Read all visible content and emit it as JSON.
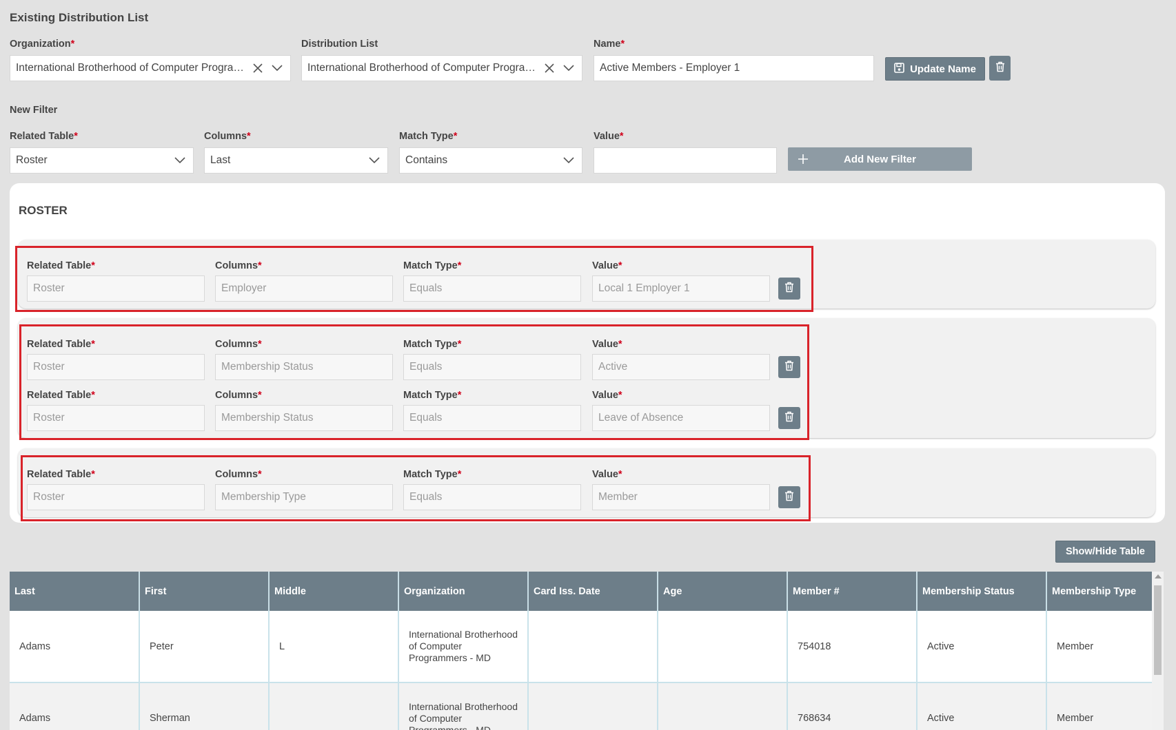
{
  "header": {
    "title": "Existing Distribution List"
  },
  "existing": {
    "organization": {
      "label": "Organization",
      "value": "International Brotherhood of Computer Programmers - MD"
    },
    "distribution_list": {
      "label": "Distribution List",
      "value": "International Brotherhood of Computer Programmers - MD"
    },
    "name": {
      "label": "Name",
      "value": "Active Members - Employer 1"
    },
    "update_name_label": "Update Name"
  },
  "new_filter": {
    "title": "New Filter",
    "related_table": {
      "label": "Related Table",
      "value": "Roster"
    },
    "columns": {
      "label": "Columns",
      "value": "Last"
    },
    "match_type": {
      "label": "Match Type",
      "value": "Contains"
    },
    "value": {
      "label": "Value",
      "value": ""
    },
    "add_label": "Add New Filter"
  },
  "roster": {
    "title": "ROSTER",
    "labels": {
      "related_table": "Related Table",
      "columns": "Columns",
      "match_type": "Match Type",
      "value": "Value"
    },
    "groups": [
      {
        "filters": [
          {
            "related_table": "Roster",
            "column": "Employer",
            "match_type": "Equals",
            "value": "Local 1 Employer 1"
          }
        ]
      },
      {
        "filters": [
          {
            "related_table": "Roster",
            "column": "Membership Status",
            "match_type": "Equals",
            "value": "Active"
          },
          {
            "related_table": "Roster",
            "column": "Membership Status",
            "match_type": "Equals",
            "value": "Leave of Absence"
          }
        ]
      },
      {
        "filters": [
          {
            "related_table": "Roster",
            "column": "Membership Type",
            "match_type": "Equals",
            "value": "Member"
          }
        ]
      }
    ]
  },
  "table": {
    "toggle_label": "Show/Hide Table",
    "columns": [
      "Last",
      "First",
      "Middle",
      "Organization",
      "Card Iss. Date",
      "Age",
      "Member #",
      "Membership Status",
      "Membership Type"
    ],
    "rows": [
      [
        "Adams",
        "Peter",
        "L",
        "International Brotherhood of Computer Programmers - MD",
        "",
        "",
        "754018",
        "Active",
        "Member"
      ],
      [
        "Adams",
        "Sherman",
        "",
        "International Brotherhood of Computer Programmers - MD",
        "",
        "",
        "768634",
        "Active",
        "Member"
      ]
    ]
  },
  "colors": {
    "accent": "#6d7e89",
    "highlight": "#d9232a",
    "required": "#d0021b",
    "background": "#e2e2e2"
  }
}
